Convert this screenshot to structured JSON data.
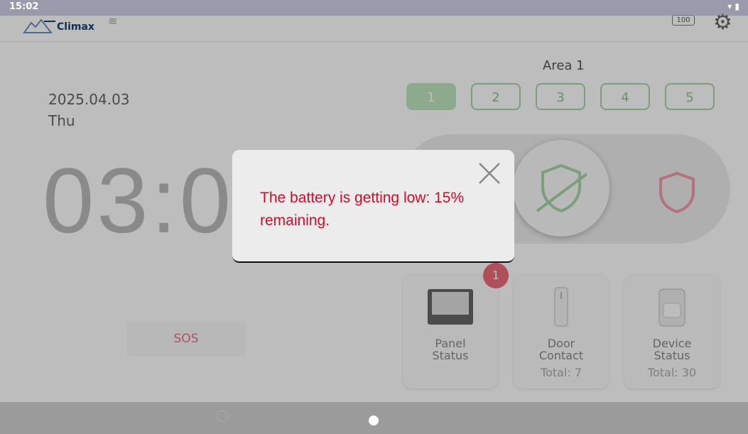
{
  "status_bar": {
    "time": "15:02"
  },
  "header": {
    "brand": "Climax",
    "battery_level": "100"
  },
  "datetime": {
    "date": "2025.04.03",
    "weekday": "Thu",
    "clock": "03:0"
  },
  "area": {
    "title": "Area 1",
    "buttons": [
      "1",
      "2",
      "3",
      "4",
      "5"
    ],
    "active": "1"
  },
  "sos": {
    "label": "SOS"
  },
  "cards": [
    {
      "label": "Panel\nStatus",
      "total": "",
      "badge": "1"
    },
    {
      "label": "Door\nContact",
      "total": "Total: 7"
    },
    {
      "label": "Device\nStatus",
      "total": "Total: 30"
    }
  ],
  "dialog": {
    "message": "The battery is getting low: 15% remaining."
  },
  "colors": {
    "accent_green": "#a6d6a8",
    "alert_red": "#c8102e",
    "badge_red": "#ee6b7a",
    "statusbar": "#9a9aad"
  },
  "icons": {
    "wifi": "wifi-icon",
    "battery": "battery-icon",
    "settings": "gear-icon",
    "disarm": "shield-slash-icon",
    "arm": "shield-icon",
    "close": "close-icon"
  }
}
